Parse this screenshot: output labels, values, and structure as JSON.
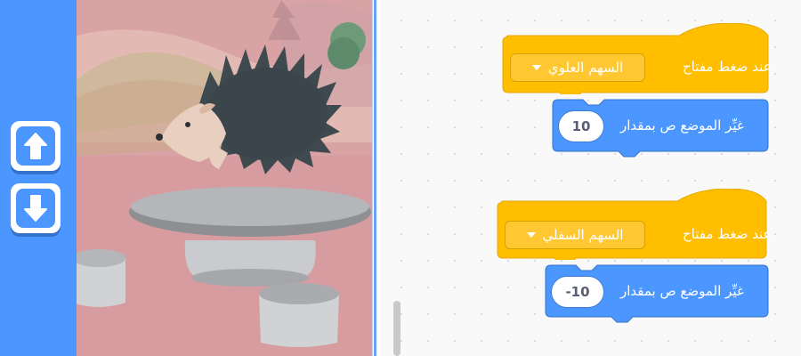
{
  "controls": {
    "up_button_icon": "arrow-up-icon",
    "down_button_icon": "arrow-down-icon"
  },
  "stage": {
    "sprite": "hedgehog",
    "backdrop": "park with stone table and stools"
  },
  "scripts": [
    {
      "hat": {
        "prefix": "عند ضغط مفتاح",
        "key": "السهم العلوي"
      },
      "motion": {
        "label": "غيِّر الموضع ص بمقدار",
        "value": "10"
      }
    },
    {
      "hat": {
        "prefix": "عند ضغط مفتاح",
        "key": "السهم السفلي"
      },
      "motion": {
        "label": "غيِّر الموضع ص بمقدار",
        "value": "-10"
      }
    }
  ],
  "colors": {
    "events": "#ffbf00",
    "motion": "#4c97ff",
    "stage_bg": "#d89fa2"
  }
}
